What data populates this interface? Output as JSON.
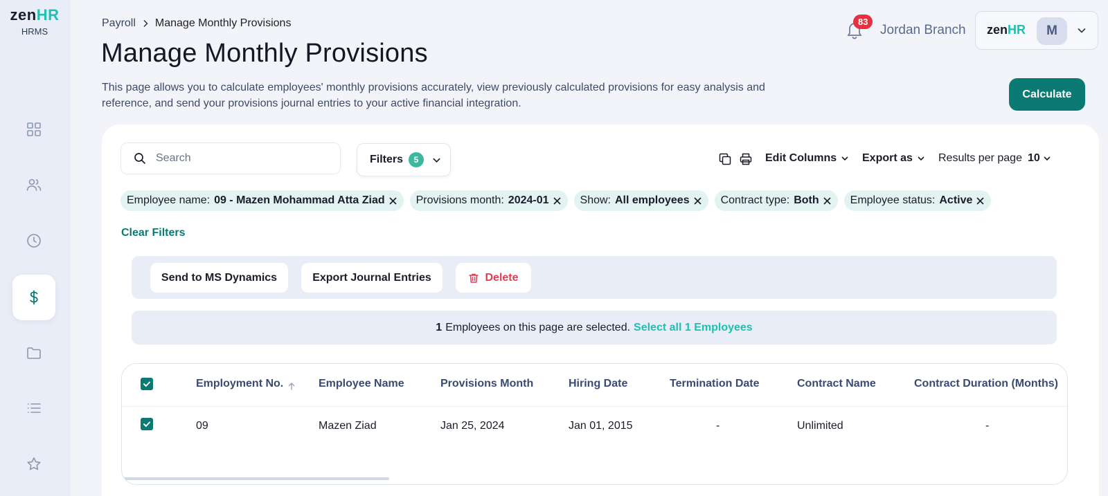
{
  "brand": {
    "logo_main": "zen",
    "logo_accent": "HR",
    "logo_sub": "HRMS"
  },
  "sidebar": {
    "items": [
      {
        "name": "dashboard",
        "icon": "grid-icon"
      },
      {
        "name": "people",
        "icon": "users-icon"
      },
      {
        "name": "time",
        "icon": "clock-icon"
      },
      {
        "name": "payroll",
        "icon": "dollar-icon",
        "active": true
      },
      {
        "name": "documents",
        "icon": "folder-icon"
      },
      {
        "name": "lists",
        "icon": "list-icon"
      },
      {
        "name": "favorites",
        "icon": "star-icon"
      }
    ]
  },
  "breadcrumb": {
    "parent": "Payroll",
    "current": "Manage Monthly Provisions"
  },
  "page": {
    "title": "Manage Monthly Provisions",
    "description": "This page allows you to calculate employees' monthly provisions accurately, view previously calculated provisions for easy analysis and reference, and send your provisions journal entries to your active financial integration."
  },
  "header": {
    "notification_count": "83",
    "user_name": "Jordan Branch",
    "account_logo_main": "zen",
    "account_logo_accent": "HR",
    "avatar_initial": "M"
  },
  "calculate_label": "Calculate",
  "toolbar": {
    "search_placeholder": "Search",
    "filters_label": "Filters",
    "filters_count": "5",
    "edit_columns_label": "Edit Columns",
    "export_as_label": "Export as",
    "results_per_page_label": "Results per page",
    "results_per_page_value": "10"
  },
  "chips": [
    {
      "key": "Employee name:",
      "value": "09 - Mazen Mohammad Atta Ziad"
    },
    {
      "key": "Provisions month:",
      "value": "2024-01"
    },
    {
      "key": "Show:",
      "value": "All employees"
    },
    {
      "key": "Contract type:",
      "value": "Both"
    },
    {
      "key": "Employee status:",
      "value": "Active"
    }
  ],
  "clear_filters_label": "Clear Filters",
  "actions": {
    "send_label": "Send to MS Dynamics",
    "export_journal_label": "Export Journal Entries",
    "delete_label": "Delete"
  },
  "selection": {
    "count": "1",
    "text": "Employees on this page are selected.",
    "select_all_label": "Select all 1 Employees"
  },
  "table": {
    "columns": [
      "Employment No.",
      "Employee Name",
      "Provisions Month",
      "Hiring Date",
      "Termination Date",
      "Contract Name",
      "Contract Duration (Months)"
    ],
    "rows": [
      {
        "employment_no": "09",
        "employee_name": "Mazen Ziad",
        "provisions_month": "Jan 25, 2024",
        "hiring_date": "Jan 01, 2015",
        "termination_date": "-",
        "contract_name": "Unlimited",
        "contract_duration": "-"
      }
    ]
  },
  "colors": {
    "accent": "#0b7a73",
    "teal": "#20bfb0",
    "danger": "#e23d55",
    "badge": "#e5303f"
  }
}
